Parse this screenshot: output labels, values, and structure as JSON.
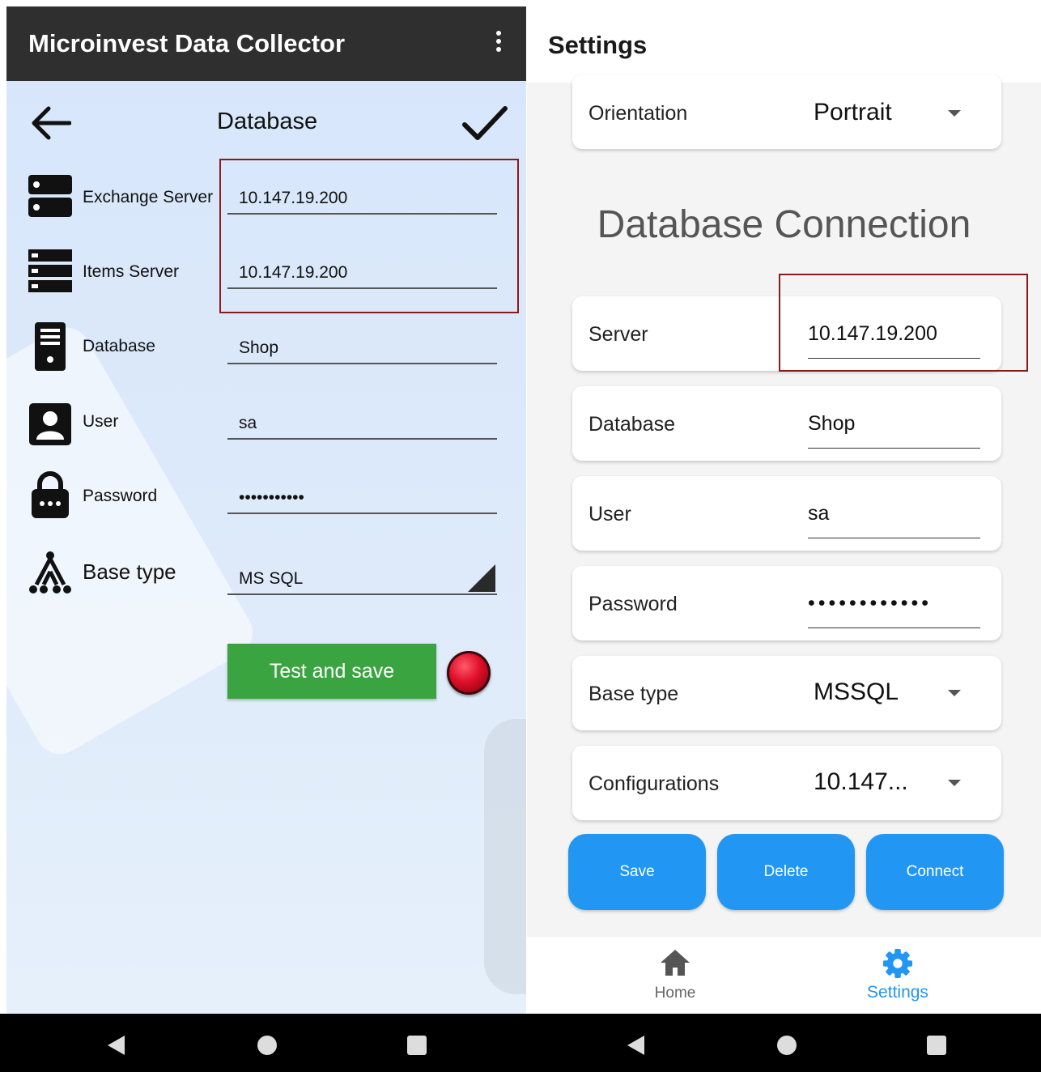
{
  "left": {
    "app_title": "Microinvest Data Collector",
    "page_title": "Database",
    "rows": [
      {
        "label": "Exchange Server",
        "value": "10.147.19.200"
      },
      {
        "label": "Items Server",
        "value": "10.147.19.200"
      },
      {
        "label": "Database",
        "value": "Shop"
      },
      {
        "label": "User",
        "value": "sa"
      },
      {
        "label": "Password",
        "value": "•••••••••••"
      },
      {
        "label": "Base type",
        "value": "MS SQL"
      }
    ],
    "test_button": "Test and save",
    "status_color": "#e0102a"
  },
  "right": {
    "title": "Settings",
    "orientation": {
      "label": "Orientation",
      "value": "Portrait"
    },
    "section_title": "Database Connection",
    "server": {
      "label": "Server",
      "value": "10.147.19.200"
    },
    "database": {
      "label": "Database",
      "value": "Shop"
    },
    "user": {
      "label": "User",
      "value": "sa"
    },
    "password": {
      "label": "Password",
      "value": "••••••••••••"
    },
    "base_type": {
      "label": "Base type",
      "value": "MSSQL"
    },
    "configurations": {
      "label": "Configurations",
      "value": "10.147..."
    },
    "buttons": {
      "save": "Save",
      "delete": "Delete",
      "connect": "Connect"
    },
    "nav": {
      "home": "Home",
      "settings": "Settings"
    },
    "accent_color": "#2196f3"
  },
  "icons": {
    "back": "arrow-left-icon",
    "confirm": "check-icon",
    "menu": "more-vertical-icon",
    "exchange_server": "server-icon",
    "items_server": "server-stack-icon",
    "database": "database-icon",
    "user": "user-icon",
    "password": "lock-icon",
    "base_type": "hierarchy-icon",
    "home": "home-icon",
    "settings": "gear-icon"
  }
}
